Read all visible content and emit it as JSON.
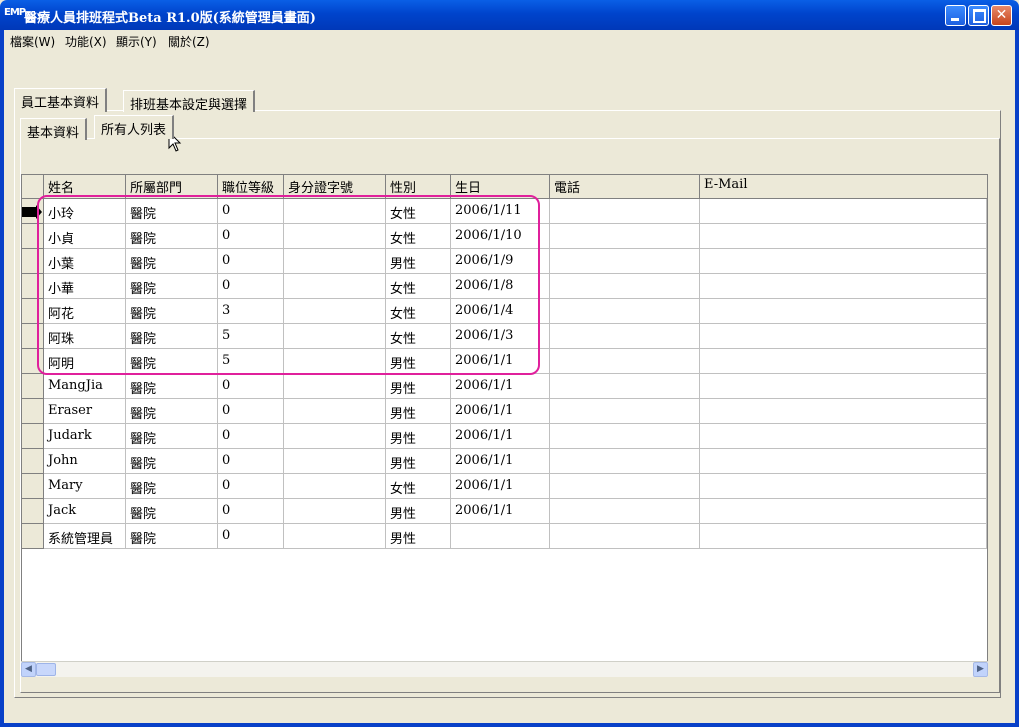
{
  "window": {
    "icon_text": "EMP",
    "title": "醫療人員排班程式Beta R1.0版(系統管理員畫面)"
  },
  "menu": [
    {
      "label": "檔案(W)"
    },
    {
      "label": "功能(X)"
    },
    {
      "label": "顯示(Y)"
    },
    {
      "label": "關於(Z)"
    }
  ],
  "outer_tabs": [
    {
      "label": "員工基本資料",
      "active": true
    },
    {
      "label": "排班基本設定與選擇",
      "active": false
    }
  ],
  "inner_tabs": [
    {
      "label": "基本資料",
      "active": false
    },
    {
      "label": "所有人列表",
      "active": true
    }
  ],
  "grid": {
    "columns": [
      "姓名",
      "所屬部門",
      "職位等級",
      "身分證字號",
      "性別",
      "生日",
      "電話",
      "E-Mail"
    ],
    "rows": [
      [
        "小玲",
        "醫院",
        "0",
        "",
        "女性",
        "2006/1/11",
        "",
        ""
      ],
      [
        "小貞",
        "醫院",
        "0",
        "",
        "女性",
        "2006/1/10",
        "",
        ""
      ],
      [
        "小葉",
        "醫院",
        "0",
        "",
        "男性",
        "2006/1/9",
        "",
        ""
      ],
      [
        "小華",
        "醫院",
        "0",
        "",
        "女性",
        "2006/1/8",
        "",
        ""
      ],
      [
        "阿花",
        "醫院",
        "3",
        "",
        "女性",
        "2006/1/4",
        "",
        ""
      ],
      [
        "阿珠",
        "醫院",
        "5",
        "",
        "女性",
        "2006/1/3",
        "",
        ""
      ],
      [
        "阿明",
        "醫院",
        "5",
        "",
        "男性",
        "2006/1/1",
        "",
        ""
      ],
      [
        "MangJia",
        "醫院",
        "0",
        "",
        "男性",
        "2006/1/1",
        "",
        ""
      ],
      [
        "Eraser",
        "醫院",
        "0",
        "",
        "男性",
        "2006/1/1",
        "",
        ""
      ],
      [
        "Judark",
        "醫院",
        "0",
        "",
        "男性",
        "2006/1/1",
        "",
        ""
      ],
      [
        "John",
        "醫院",
        "0",
        "",
        "男性",
        "2006/1/1",
        "",
        ""
      ],
      [
        "Mary",
        "醫院",
        "0",
        "",
        "女性",
        "2006/1/1",
        "",
        ""
      ],
      [
        "Jack",
        "醫院",
        "0",
        "",
        "男性",
        "2006/1/1",
        "",
        ""
      ],
      [
        "系統管理員",
        "醫院",
        "0",
        "",
        "男性",
        "",
        "",
        ""
      ]
    ]
  },
  "colors": {
    "titlebar": "#0044cc",
    "highlight": "#e0209c",
    "window_bg": "#ece9d8"
  }
}
